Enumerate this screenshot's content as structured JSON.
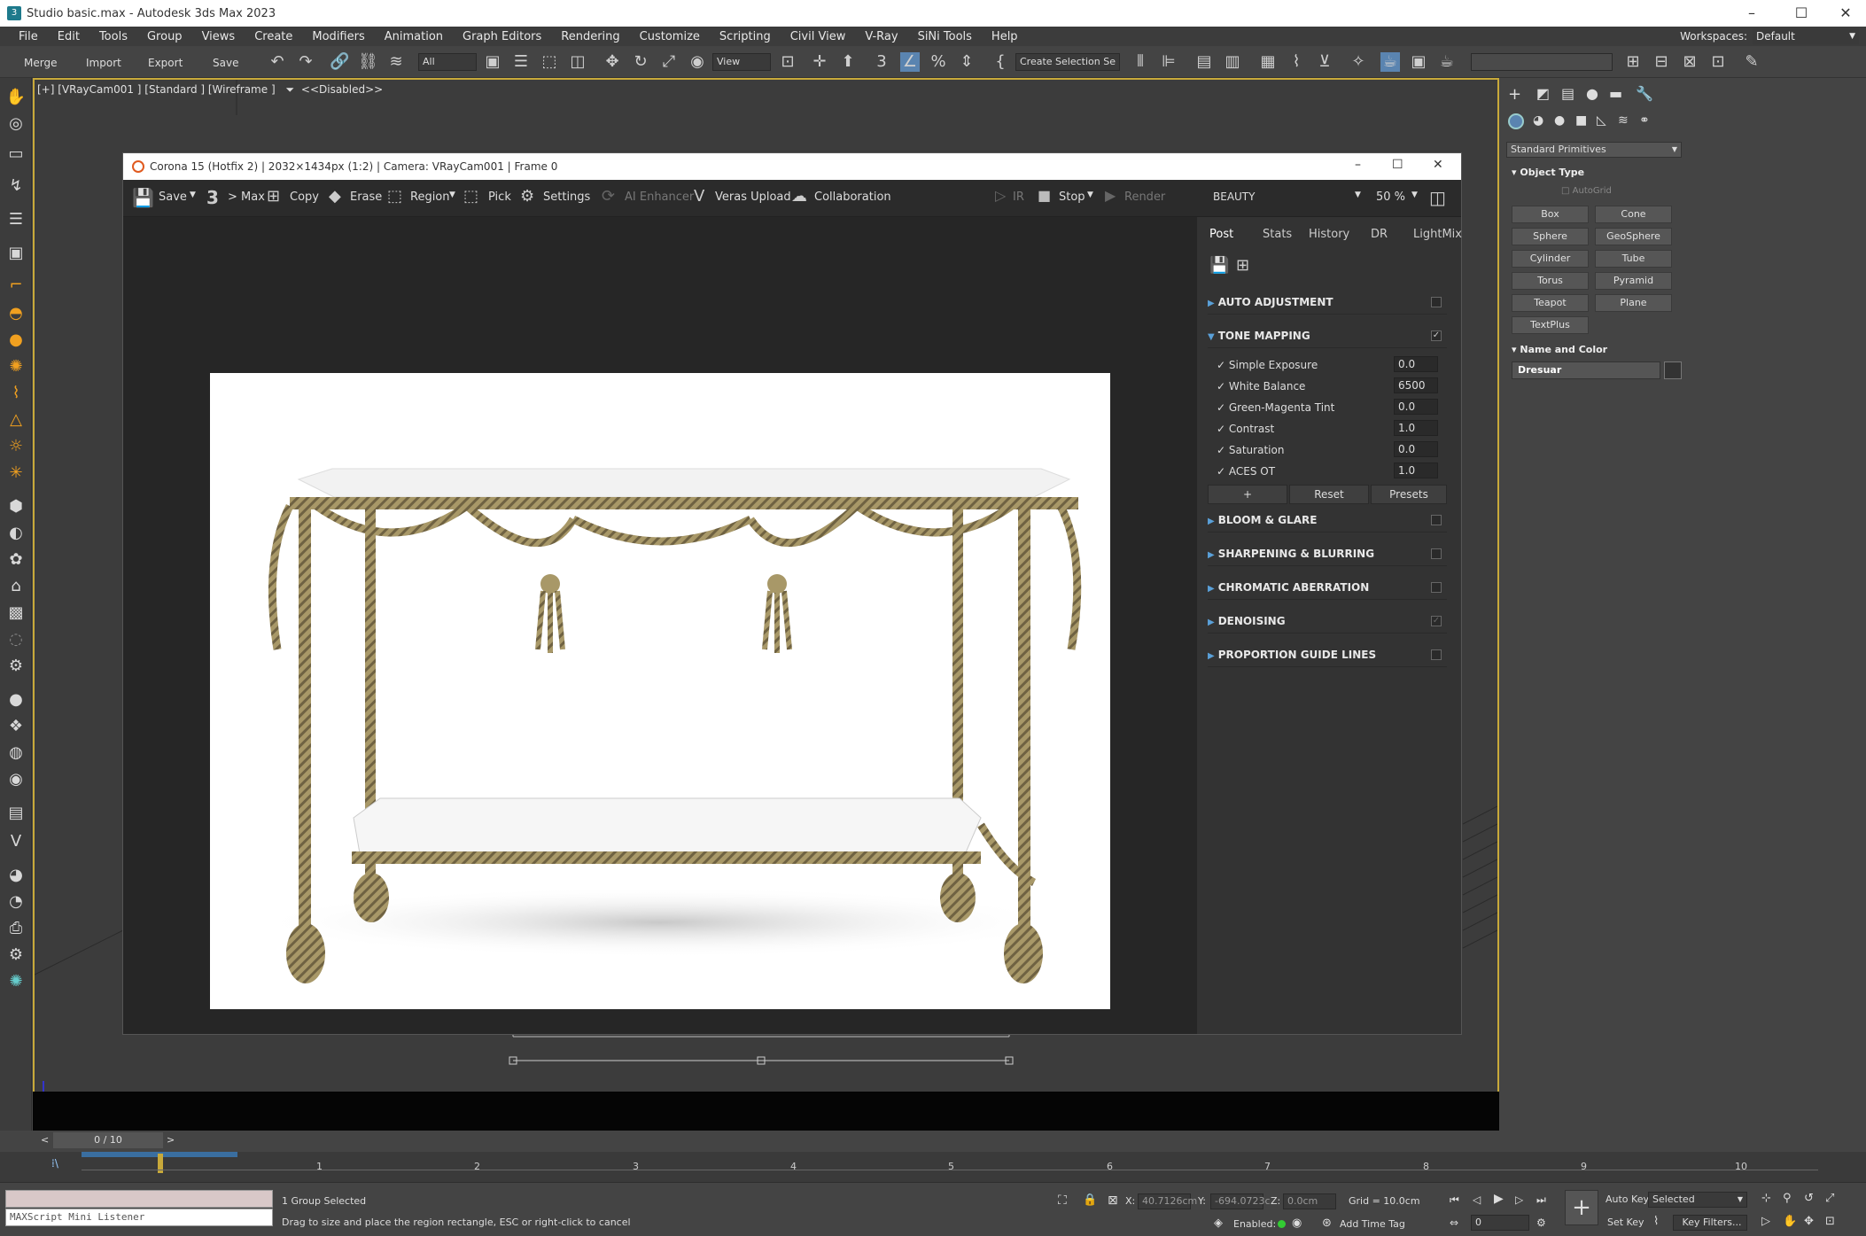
{
  "window": {
    "title": "Studio basic.max - Autodesk 3ds Max 2023"
  },
  "menu": [
    "File",
    "Edit",
    "Tools",
    "Group",
    "Views",
    "Create",
    "Modifiers",
    "Animation",
    "Graph Editors",
    "Rendering",
    "Customize",
    "Scripting",
    "Civil View",
    "V-Ray",
    "SiNi Tools",
    "Help"
  ],
  "workspaces": {
    "label": "Workspaces:",
    "value": "Default"
  },
  "toolbar": {
    "merge": "Merge",
    "import": "Import",
    "export": "Export",
    "save": "Save",
    "filter": "All",
    "refcoord": "View",
    "selset": "Create Selection Se"
  },
  "viewport": {
    "label": "[+] [VRayCam001 ] [Standard ] [Wireframe ]",
    "filter": "<<Disabled>>"
  },
  "vfb": {
    "title": "Corona 15 (Hotfix 2) | 2032×1434px (1:2) | Camera: VRayCam001 | Frame 0",
    "toolbar": {
      "save": "Save",
      "max": "> Max",
      "copy": "Copy",
      "erase": "Erase",
      "region": "Region",
      "pick": "Pick",
      "settings": "Settings",
      "ai": "AI Enhancer",
      "veras": "Veras Upload",
      "collab": "Collaboration",
      "ir": "IR",
      "stop": "Stop",
      "render": "Render",
      "channel": "BEAUTY",
      "zoom": "50 %"
    },
    "tabs": [
      "Post",
      "Stats",
      "History",
      "DR",
      "LightMix"
    ],
    "sections": {
      "auto": "AUTO ADJUSTMENT",
      "tone": "TONE MAPPING",
      "bloom": "BLOOM & GLARE",
      "sharp": "SHARPENING & BLURRING",
      "chrom": "CHROMATIC ABERRATION",
      "denoise": "DENOISING",
      "guides": "PROPORTION GUIDE LINES"
    },
    "tone_rows": [
      {
        "label": "Simple Exposure",
        "value": "0.0"
      },
      {
        "label": "White Balance",
        "value": "6500"
      },
      {
        "label": "Green-Magenta Tint",
        "value": "0.0"
      },
      {
        "label": "Contrast",
        "value": "1.0"
      },
      {
        "label": "Saturation",
        "value": "0.0"
      },
      {
        "label": "ACES OT",
        "value": "1.0"
      }
    ],
    "tone_buttons": {
      "add": "+",
      "reset": "Reset",
      "presets": "Presets"
    }
  },
  "command_panel": {
    "category": "Standard Primitives",
    "object_type": "Object Type",
    "autogrid": "AutoGrid",
    "buttons": [
      "Box",
      "Cone",
      "Sphere",
      "GeoSphere",
      "Cylinder",
      "Tube",
      "Torus",
      "Pyramid",
      "Teapot",
      "Plane",
      "TextPlus"
    ],
    "name_color": "Name and Color",
    "name_value": "Dresuar"
  },
  "timeline": {
    "frame": "0 / 10",
    "ticks": [
      "1",
      "2",
      "3",
      "4",
      "5",
      "6",
      "7",
      "8",
      "9",
      "10"
    ]
  },
  "status": {
    "listener": "MAXScript Mini Listener",
    "selected": "1 Group Selected",
    "prompt": "Drag to size and place the region rectangle, ESC or right-click to cancel",
    "x_label": "X:",
    "x": "40.7126cm",
    "y_label": "Y:",
    "y": "-694.0723c",
    "z_label": "Z:",
    "z": "0.0cm",
    "grid": "Grid = 10.0cm",
    "enabled": "Enabled:",
    "add_time_tag": "Add Time Tag",
    "auto_key": "Auto Key",
    "set_key": "Set Key",
    "key_mode": "Selected",
    "key_filters": "Key Filters...",
    "frame_field": "0"
  },
  "colors": {
    "viewport_border": "#c8a93a",
    "accent": "#5aa0d8",
    "rope": "#a89868"
  }
}
